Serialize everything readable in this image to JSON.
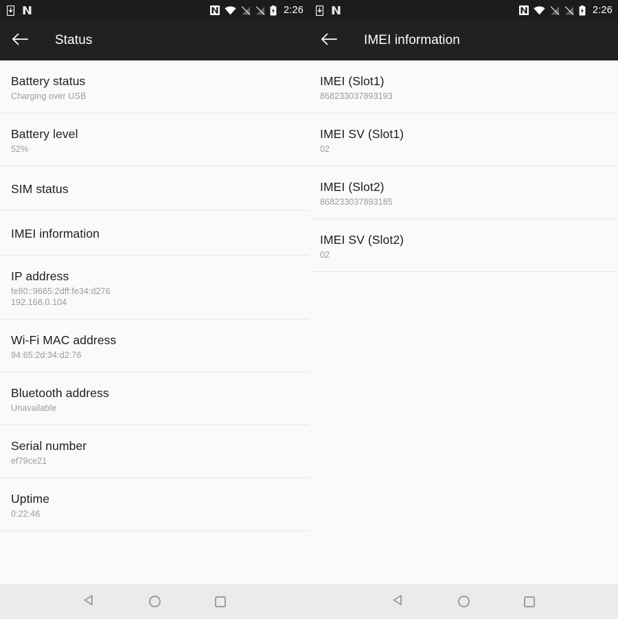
{
  "theme": {
    "statusbar_bg": "#1c1c1c",
    "actionbar_bg": "#212121",
    "list_bg": "#fafafa",
    "navbar_bg": "#ebebeb",
    "divider": "#e6e6e6",
    "primary_text": "#1d1d1d",
    "secondary_text": "#9a9a9a",
    "icon_white": "#ffffff",
    "nav_icon": "#9b9b9b"
  },
  "statusbar": {
    "time": "2:26",
    "left_icons": [
      "phone-download-icon",
      "nfc-n-icon"
    ],
    "right_icons": [
      "nfc-n-icon",
      "wifi-icon",
      "no-sim-signal-icon",
      "no-sim-signal-icon",
      "battery-charging-icon"
    ]
  },
  "navbar": {
    "back_label": "Back",
    "home_label": "Home",
    "recents_label": "Recents",
    "icons": [
      "nav-back-triangle-icon",
      "nav-home-circle-icon",
      "nav-recents-square-icon"
    ]
  },
  "left_panel": {
    "back_icon": "arrow-back-icon",
    "title": "Status",
    "items": [
      {
        "title": "Battery status",
        "sub": [
          "Charging over USB"
        ]
      },
      {
        "title": "Battery level",
        "sub": [
          "52%"
        ]
      },
      {
        "title": "SIM status",
        "sub": []
      },
      {
        "title": "IMEI information",
        "sub": []
      },
      {
        "title": "IP address",
        "sub": [
          "fe80::9665:2dff:fe34:d276",
          "192.168.0.104"
        ]
      },
      {
        "title": "Wi-Fi MAC address",
        "sub": [
          "94:65:2d:34:d2:76"
        ]
      },
      {
        "title": "Bluetooth address",
        "sub": [
          "Unavailable"
        ]
      },
      {
        "title": "Serial number",
        "sub": [
          "ef79ce21"
        ]
      },
      {
        "title": "Uptime",
        "sub": [
          "0:22:46"
        ]
      }
    ]
  },
  "right_panel": {
    "back_icon": "arrow-back-icon",
    "title": "IMEI information",
    "items": [
      {
        "title": "IMEI (Slot1)",
        "sub": [
          "868233037893193"
        ]
      },
      {
        "title": "IMEI SV (Slot1)",
        "sub": [
          "02"
        ]
      },
      {
        "title": "IMEI (Slot2)",
        "sub": [
          "868233037893185"
        ]
      },
      {
        "title": "IMEI SV (Slot2)",
        "sub": [
          "02"
        ]
      }
    ]
  }
}
